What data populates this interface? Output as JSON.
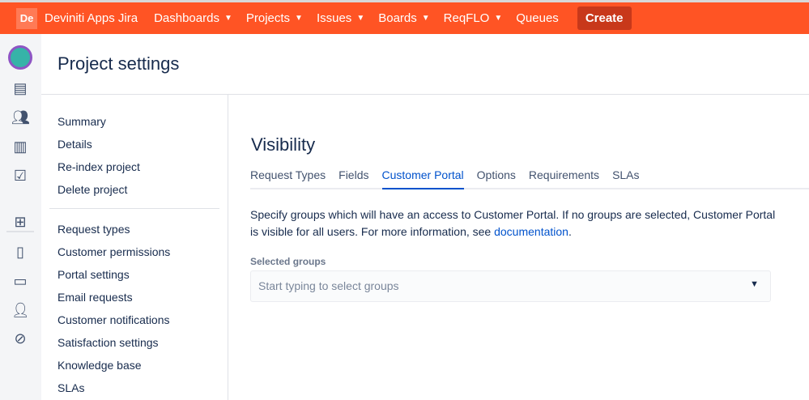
{
  "topbar": {
    "logo": "De",
    "brand": "Deviniti Apps Jira",
    "nav": [
      "Dashboards",
      "Projects",
      "Issues",
      "Boards",
      "ReqFLO"
    ],
    "queues": "Queues",
    "create": "Create"
  },
  "page_title": "Project settings",
  "sidebar": {
    "group1": [
      "Summary",
      "Details",
      "Re-index project",
      "Delete project"
    ],
    "group2": [
      "Request types",
      "Customer permissions",
      "Portal settings",
      "Email requests",
      "Customer notifications",
      "Satisfaction settings",
      "Knowledge base",
      "SLAs"
    ]
  },
  "main": {
    "title": "Visibility",
    "tabs": [
      "Request Types",
      "Fields",
      "Customer Portal",
      "Options",
      "Requirements",
      "SLAs"
    ],
    "active_tab": "Customer Portal",
    "description": "Specify groups which will have an access to Customer Portal. If no groups are selected, Customer Portal is visible for all users. For more information, see ",
    "doc_link": "documentation",
    "selected_groups_label": "Selected groups",
    "select_placeholder": "Start typing to select groups"
  },
  "colors": {
    "topbar": "#ff5424",
    "link": "#0052cc"
  }
}
